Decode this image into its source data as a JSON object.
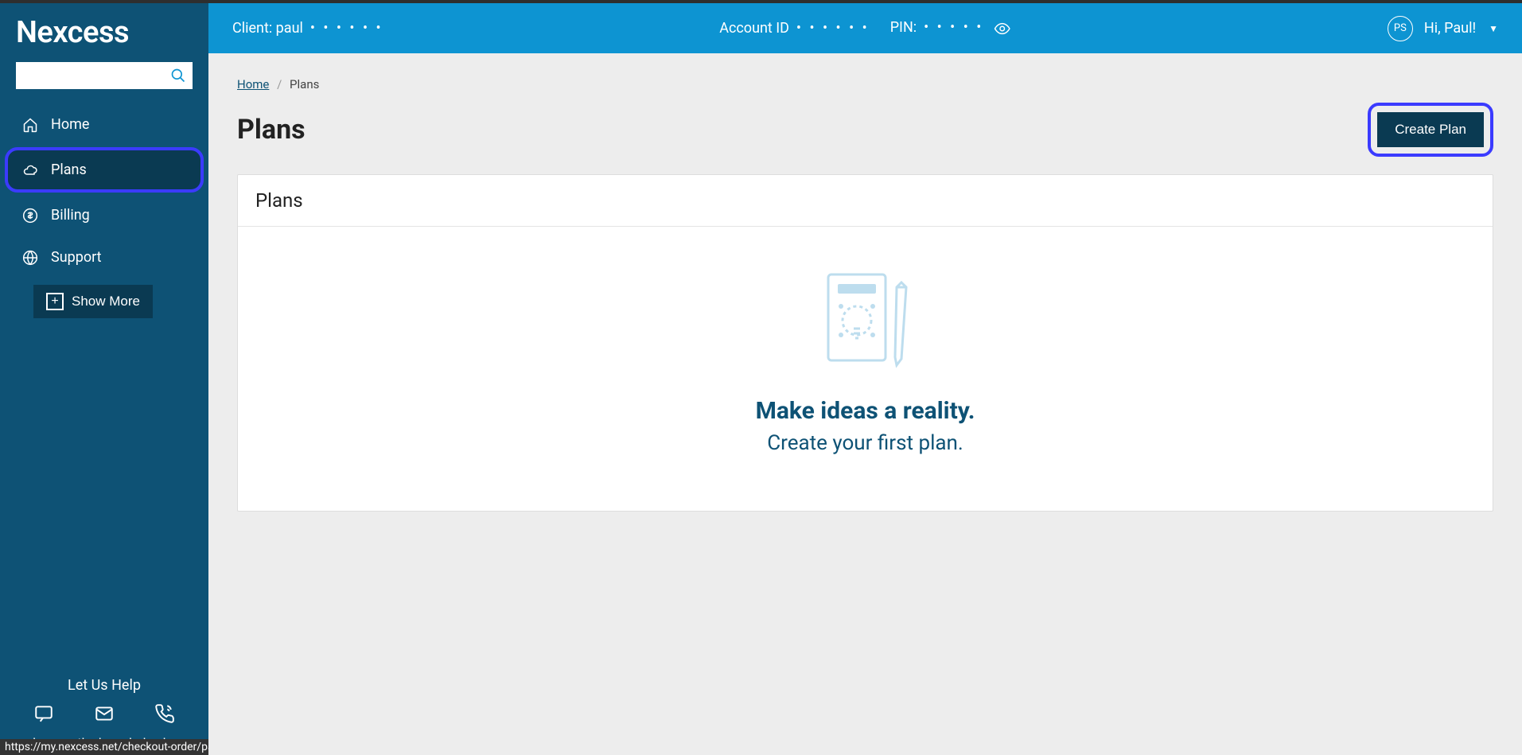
{
  "brand": "Nexcess",
  "sidebar": {
    "search_placeholder": "",
    "items": [
      {
        "label": "Home",
        "icon": "home-icon"
      },
      {
        "label": "Plans",
        "icon": "cloud-icon",
        "active": true
      },
      {
        "label": "Billing",
        "icon": "dollar-icon"
      },
      {
        "label": "Support",
        "icon": "globe-icon"
      }
    ],
    "show_more": "Show More"
  },
  "sidebar_footer": {
    "help_title": "Let Us Help",
    "kb_link": "or browse the knowledge base"
  },
  "topbar": {
    "client_label": "Client: paul",
    "client_mask": "• • • • • •",
    "account_label": "Account ID",
    "account_mask": "• • • • • •",
    "pin_label": "PIN:",
    "pin_mask": "• • • • •",
    "avatar_initials": "PS",
    "greeting": "Hi, Paul!"
  },
  "breadcrumb": {
    "home": "Home",
    "current": "Plans"
  },
  "page": {
    "title": "Plans",
    "create_button": "Create Plan"
  },
  "card": {
    "header": "Plans",
    "empty_title": "Make ideas a reality.",
    "empty_sub": "Create your first plan."
  },
  "status_url": "https://my.nexcess.net/checkout-order/package"
}
